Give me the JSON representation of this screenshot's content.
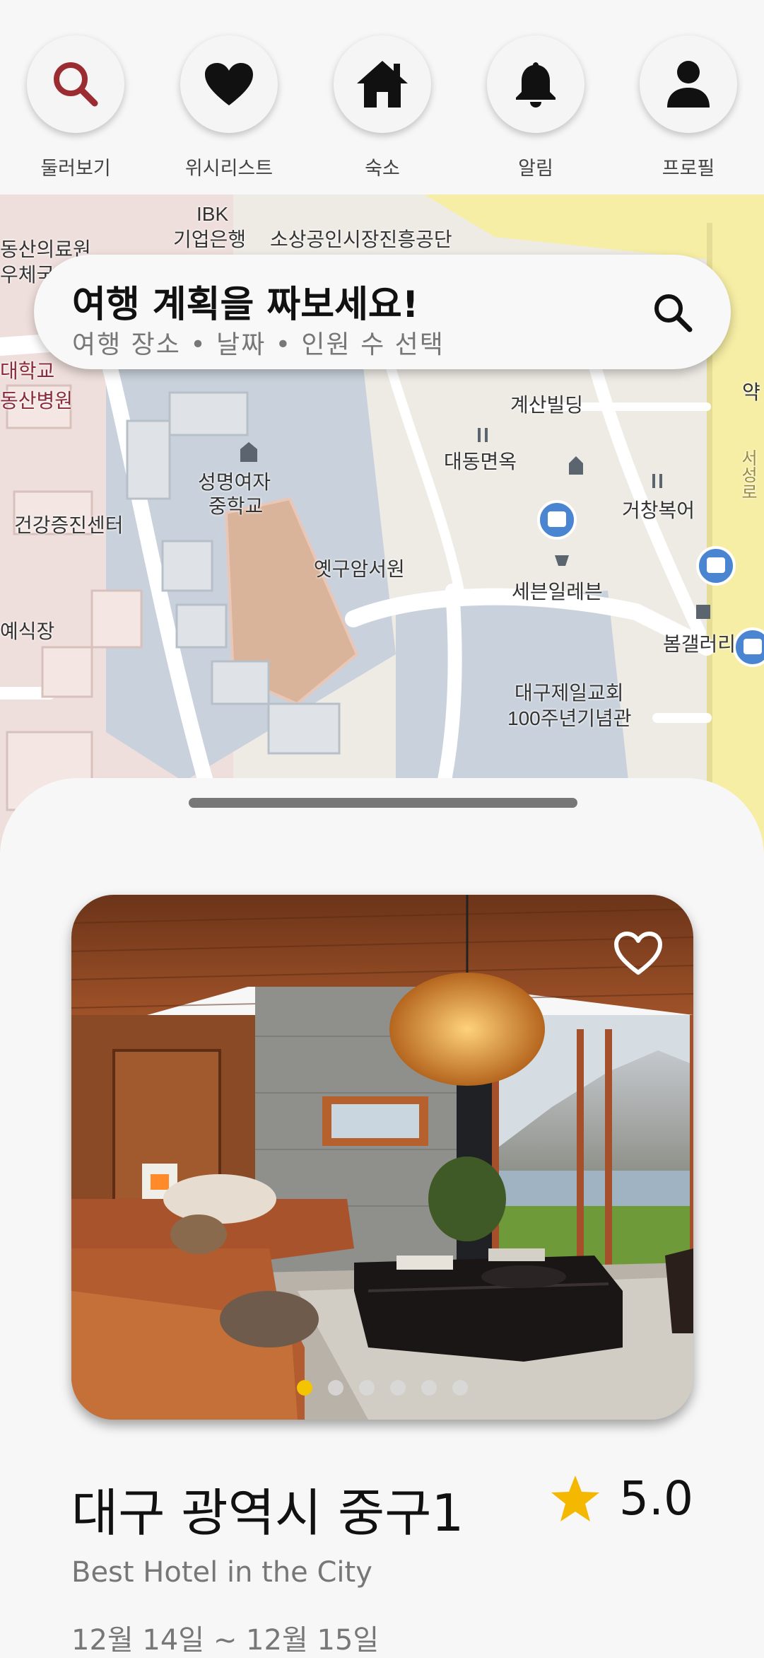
{
  "nav": {
    "items": [
      {
        "label": "둘러보기",
        "icon": "search-icon"
      },
      {
        "label": "위시리스트",
        "icon": "heart-icon"
      },
      {
        "label": "숙소",
        "icon": "home-icon"
      },
      {
        "label": "알림",
        "icon": "bell-icon"
      },
      {
        "label": "프로필",
        "icon": "person-icon"
      }
    ],
    "active_color": "#9b2d32"
  },
  "map": {
    "labels": {
      "ibk": "IBK",
      "bank": "기업은행",
      "agency": "소상공인시장진흥공단",
      "left1": "동산의료원",
      "left2": "우체국",
      "univ": "대학교",
      "hospital": "동산병원",
      "building": "계산빌딩",
      "school": "성명여자",
      "school2": "중학교",
      "noodle": "대동면옥",
      "health": "건강증진센터",
      "restaurant": "거창복어",
      "herb": "옛구암서원",
      "seven": "세븐일레븐",
      "gallery": "봄갤러리",
      "ceremony": "예식장",
      "church": "대구제일교회",
      "church2": "100주년기념관",
      "right_edge": "약",
      "road": "서성로"
    }
  },
  "search": {
    "title": "여행 계획을 짜보세요!",
    "subtitle": "여행 장소 • 날짜 • 인원 수 선택"
  },
  "listing": {
    "title": "대구 광역시 중구1",
    "rating": "5.0",
    "subtitle": "Best Hotel in the City",
    "dates": "12월 14일 ~ 12월 15일",
    "image_count": 6,
    "active_image_index": 0,
    "accent": "#f5c400"
  }
}
